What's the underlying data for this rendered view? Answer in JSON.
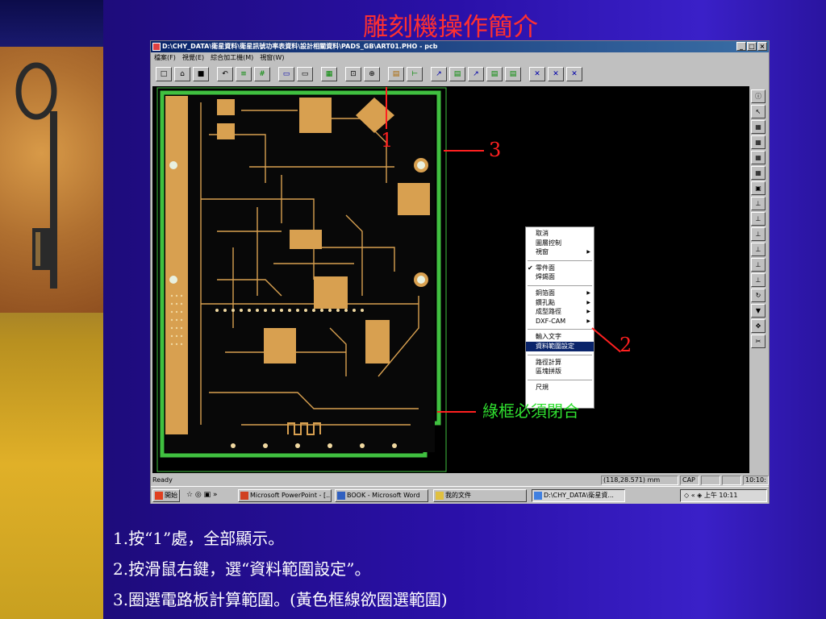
{
  "slide": {
    "title": "雕刻機操作簡介",
    "notes": [
      "1.按“1”處，全部顯示。",
      "2.按滑鼠右鍵，選“資料範圍設定”。",
      "3.圈選電路板計算範圍。(黃色框線欲圈選範圍)"
    ],
    "annotations": {
      "label_1": "1",
      "label_2": "2",
      "label_3": "3",
      "green_note": "綠框必須閉合"
    },
    "colors": {
      "title": "#ff3030",
      "annotation": "#ff2020",
      "green_note": "#30e030",
      "pcb_copper": "#d8a050",
      "board_frame": "#40c040"
    }
  },
  "window": {
    "title": "D:\\CHY_DATA\\衛星資料\\衛星訊號功率表資料\\設計相關資料\\PADS_GB\\ART01.PHO - pcb",
    "menu": [
      "檔案(F)",
      "視覺(E)",
      "綜合加工機(M)",
      "視窗(W)"
    ],
    "toolbar_icons": [
      "new-icon",
      "open-icon",
      "save-icon",
      "undo-icon",
      "layer-icon",
      "grid-icon",
      "select-icon",
      "frame-icon",
      "fill-icon",
      "zoom-icon",
      "zoom-all-icon",
      "data-icon",
      "measure-icon",
      "route1-icon",
      "route2-icon",
      "route3-icon",
      "route4-icon",
      "route5-icon",
      "drill1-icon",
      "drill2-icon",
      "drill3-icon"
    ]
  },
  "context_menu": {
    "items": [
      {
        "label": "取消",
        "submenu": false
      },
      {
        "label": "圖層控制",
        "submenu": false
      },
      {
        "label": "視窗",
        "submenu": true
      },
      {
        "sep": true
      },
      {
        "label": "零件面",
        "checked": true
      },
      {
        "label": "焊錫面"
      },
      {
        "sep": true
      },
      {
        "label": "銅箔面",
        "submenu": true
      },
      {
        "label": "鑽孔點",
        "submenu": true
      },
      {
        "label": "成型路徑",
        "submenu": true
      },
      {
        "label": "DXF-CAM",
        "submenu": true
      },
      {
        "sep": true
      },
      {
        "label": "輸入文字"
      },
      {
        "label": "資料範圍設定",
        "selected": true
      },
      {
        "sep": true
      },
      {
        "label": "路徑計算"
      },
      {
        "label": "區塊拼版"
      },
      {
        "sep": true
      },
      {
        "label": "尺規"
      }
    ]
  },
  "statusbar": {
    "ready": "Ready",
    "coords": "(118,28.571) mm",
    "cap": "CAP",
    "time_cell": "10:10:"
  },
  "taskbar": {
    "start": "開始",
    "tasks": [
      "Microsoft PowerPoint - [...",
      "BOOK - Microsoft Word",
      "我的文件",
      "D:\\CHY_DATA\\衛星資..."
    ],
    "clock": "上午 10:11"
  }
}
